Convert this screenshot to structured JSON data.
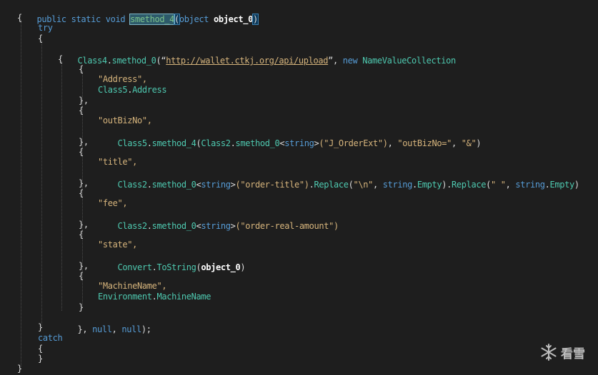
{
  "code": {
    "sig": {
      "kw1": "public",
      "kw2": "static",
      "kw3": "void",
      "method": "smethod_4",
      "paren_open": "(",
      "ptype": "object",
      "pname": "object_0",
      "paren_close": ")"
    },
    "brace_open": "{",
    "brace_close": "}",
    "try_kw": "try",
    "call": {
      "cls": "Class4",
      "method": "smethod_0",
      "url": "http://wallet.ctkj.org/api/upload",
      "new_kw": "new",
      "type": "NameValueCollection"
    },
    "entries": [
      {
        "key": "\"Address\",",
        "v_cls": "Class5",
        "v_member": "Address",
        "v_rest": ""
      },
      {
        "key": "\"outBizNo\",",
        "v_cls": "Class5",
        "v_member": "smethod_4",
        "v_rest": ""
      },
      {
        "key": "\"title\",",
        "v_cls": "Class2",
        "v_member": "smethod_0",
        "v_rest": ""
      },
      {
        "key": "\"fee\",",
        "v_cls": "Class2",
        "v_member": "smethod_0",
        "v_rest": ""
      },
      {
        "key": "\"state\",",
        "v_cls": "Convert",
        "v_member": "ToString",
        "v_rest": ""
      },
      {
        "key": "\"MachineName\",",
        "v_cls": "Environment",
        "v_member": "MachineName",
        "v_rest": ""
      }
    ],
    "outbizno_tail": {
      "p1": "(",
      "c2": "Class2",
      "m2": "smethod_0",
      "lt": "<",
      "t": "string",
      "gt": ">",
      "s1": "(\"J_OrderExt\")",
      "c1": ", ",
      "s2": "\"outBizNo=\"",
      "c3": ", ",
      "s3": "\"&\"",
      "end": ")"
    },
    "title_tail": {
      "lt": "<",
      "t": "string",
      "gt": ">",
      "s1": "(\"order-title\")",
      "dot": ".",
      "rep": "Replace",
      "p": "(",
      "s2": "\"\\n\"",
      "c": ", ",
      "strkw": "string",
      "dot2": ".",
      "empty": "Empty",
      "end": ").",
      "rep2": "Replace",
      "p2": "(",
      "s3": "\" \"",
      "c2": ", ",
      "strkw2": "string",
      "dot3": ".",
      "empty2": "Empty",
      "end2": ")"
    },
    "fee_tail": {
      "lt": "<",
      "t": "string",
      "gt": ">",
      "s1": "(\"order-real-amount\")"
    },
    "state_tail": {
      "p": "(",
      "arg": "object_0",
      "end": ")"
    },
    "close_call": {
      "b": "},",
      "n1": "null",
      "c": ",",
      "n2": "null",
      "e": ");"
    },
    "entry_open": "{",
    "entry_close": "},",
    "entry_close_last": "}",
    "catch_kw": "catch"
  },
  "watermark": {
    "text": "看雪",
    "icon": "snowflake-icon"
  }
}
